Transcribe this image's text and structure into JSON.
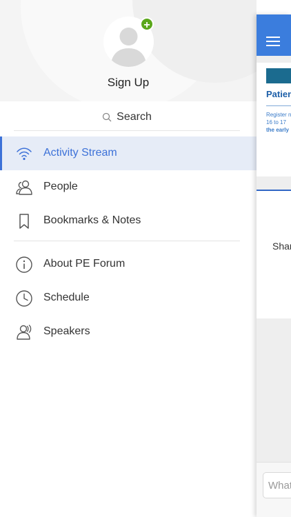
{
  "profile": {
    "signup_label": "Sign Up",
    "add_badge": "+"
  },
  "search": {
    "label": "Search"
  },
  "nav": {
    "items": [
      {
        "label": "Activity Stream",
        "icon": "wifi-icon",
        "active": true
      },
      {
        "label": "People",
        "icon": "people-icon",
        "active": false
      },
      {
        "label": "Bookmarks & Notes",
        "icon": "bookmark-icon",
        "active": false
      },
      {
        "label": "About PE Forum",
        "icon": "info-icon",
        "active": false
      },
      {
        "label": "Schedule",
        "icon": "clock-icon",
        "active": false
      },
      {
        "label": "Speakers",
        "icon": "speakers-icon",
        "active": false
      }
    ]
  },
  "panel": {
    "banner_title": "Patien",
    "banner_text_1": "Register n",
    "banner_text_2": "16 to 17",
    "banner_text_3": "the early",
    "post_text": "Shar",
    "composer_placeholder": "What"
  },
  "colors": {
    "accent": "#3c71d8",
    "active_bg": "#e6ecf7",
    "topbar": "#3b7ddd",
    "add_badge": "#5aa71a"
  }
}
